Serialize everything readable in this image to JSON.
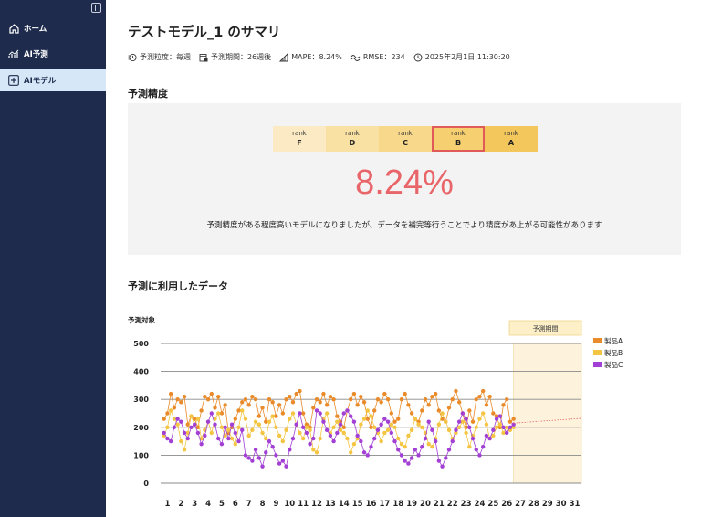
{
  "sidebar": {
    "items": [
      {
        "label": "ホーム",
        "icon": "home-icon"
      },
      {
        "label": "AI予測",
        "icon": "chart-line-icon"
      },
      {
        "label": "AIモデル",
        "icon": "ai-model-icon",
        "active": true
      }
    ]
  },
  "page": {
    "title": "テストモデル_1 のサマリ"
  },
  "meta": {
    "granularity": "予測粒度：毎週",
    "period": "予測期間：26週後",
    "mape": "MAPE：8.24%",
    "rmse": "RMSE：234",
    "timestamp": "2025年2月1日 11:30:20"
  },
  "accuracy": {
    "section_title": "予測精度",
    "ranks": [
      {
        "caption": "rank",
        "value": "F",
        "color": "#fbeac3"
      },
      {
        "caption": "rank",
        "value": "D",
        "color": "#f9e0a3"
      },
      {
        "caption": "rank",
        "value": "C",
        "color": "#f8d88b"
      },
      {
        "caption": "rank",
        "value": "B",
        "color": "#f6cf70",
        "selected": true
      },
      {
        "caption": "rank",
        "value": "A",
        "color": "#f4c75c"
      }
    ],
    "score": "8.24%",
    "comment": "予測精度がある程度高いモデルになりましたが、データを補完等行うことでより精度があ上がる可能性があります"
  },
  "data_section": {
    "title": "予測に利用したデータ"
  },
  "colors": {
    "sidebar_bg": "#1f2b4d",
    "accent_red": "#e8666a",
    "productA": "#e98b2a",
    "productB": "#f4c542",
    "productC": "#a23fd4",
    "forecast_band": "#fdf3dc"
  },
  "chart_data": {
    "type": "line",
    "ylabel": "予測対象",
    "forecast_label": "予測期間",
    "ylim": [
      0,
      500
    ],
    "yticks": [
      0,
      100,
      200,
      300,
      400,
      500
    ],
    "xticks": [
      1,
      2,
      3,
      4,
      5,
      6,
      7,
      8,
      9,
      10,
      11,
      12,
      13,
      14,
      15,
      16,
      17,
      18,
      19,
      20,
      21,
      22,
      23,
      24,
      25,
      26,
      27,
      28,
      29,
      30,
      31
    ],
    "x_range": [
      0,
      31
    ],
    "forecast_start": 26,
    "x": [
      0.25,
      0.5,
      0.75,
      1,
      1.25,
      1.5,
      1.75,
      2,
      2.25,
      2.5,
      2.75,
      3,
      3.25,
      3.5,
      3.75,
      4,
      4.25,
      4.5,
      4.75,
      5,
      5.25,
      5.5,
      5.75,
      6,
      6.25,
      6.5,
      6.75,
      7,
      7.25,
      7.5,
      7.75,
      8,
      8.25,
      8.5,
      8.75,
      9,
      9.25,
      9.5,
      9.75,
      10,
      10.25,
      10.5,
      10.75,
      11,
      11.25,
      11.5,
      11.75,
      12,
      12.25,
      12.5,
      12.75,
      13,
      13.25,
      13.5,
      13.75,
      14,
      14.25,
      14.5,
      14.75,
      15,
      15.25,
      15.5,
      15.75,
      16,
      16.25,
      16.5,
      16.75,
      17,
      17.25,
      17.5,
      17.75,
      18,
      18.25,
      18.5,
      18.75,
      19,
      19.25,
      19.5,
      19.75,
      20,
      20.25,
      20.5,
      20.75,
      21,
      21.25,
      21.5,
      21.75,
      22,
      22.25,
      22.5,
      22.75,
      23,
      23.25,
      23.5,
      23.75,
      24,
      24.25,
      24.5,
      24.75,
      25,
      25.25,
      25.5,
      25.75,
      26
    ],
    "series": [
      {
        "name": "製品A",
        "values": [
          230,
          250,
          320,
          270,
          300,
          290,
          310,
          210,
          240,
          230,
          200,
          260,
          310,
          300,
          320,
          270,
          310,
          250,
          280,
          180,
          200,
          230,
          260,
          290,
          300,
          280,
          310,
          300,
          240,
          270,
          220,
          300,
          290,
          240,
          280,
          250,
          300,
          310,
          290,
          320,
          330,
          250,
          210,
          200,
          270,
          300,
          290,
          320,
          280,
          310,
          300,
          240,
          220,
          200,
          260,
          300,
          320,
          280,
          310,
          290,
          230,
          200,
          260,
          300,
          290,
          320,
          300,
          250,
          220,
          230,
          300,
          320,
          280,
          250,
          230,
          220,
          260,
          300,
          280,
          310,
          320,
          260,
          230,
          220,
          270,
          300,
          330,
          290,
          250,
          200,
          260,
          220,
          300,
          310,
          330,
          280,
          310,
          250,
          240,
          200,
          280,
          300,
          220,
          230
        ]
      },
      {
        "name": "製品B",
        "values": [
          170,
          200,
          260,
          230,
          210,
          150,
          120,
          180,
          240,
          210,
          230,
          160,
          190,
          220,
          180,
          230,
          250,
          200,
          170,
          190,
          160,
          140,
          200,
          260,
          230,
          170,
          190,
          220,
          210,
          180,
          160,
          220,
          240,
          200,
          170,
          150,
          190,
          230,
          250,
          210,
          180,
          160,
          200,
          190,
          120,
          110,
          160,
          230,
          250,
          180,
          200,
          220,
          190,
          180,
          160,
          110,
          140,
          160,
          210,
          230,
          260,
          240,
          200,
          180,
          150,
          180,
          190,
          210,
          200,
          160,
          140,
          130,
          170,
          190,
          230,
          210,
          200,
          180,
          140,
          130,
          160,
          210,
          250,
          220,
          190,
          160,
          180,
          200,
          220,
          180,
          130,
          170,
          200,
          230,
          250,
          210,
          160,
          170,
          200,
          210,
          180,
          200,
          190,
          200
        ]
      },
      {
        "name": "製品C",
        "values": [
          180,
          160,
          150,
          200,
          230,
          220,
          180,
          160,
          200,
          210,
          180,
          140,
          170,
          220,
          250,
          210,
          160,
          140,
          200,
          160,
          210,
          180,
          150,
          190,
          100,
          90,
          80,
          120,
          90,
          60,
          110,
          150,
          130,
          100,
          70,
          80,
          60,
          120,
          160,
          210,
          250,
          200,
          180,
          140,
          160,
          260,
          250,
          220,
          190,
          170,
          150,
          180,
          210,
          250,
          260,
          240,
          220,
          170,
          150,
          110,
          100,
          130,
          160,
          190,
          210,
          230,
          220,
          180,
          150,
          120,
          100,
          80,
          70,
          90,
          120,
          100,
          130,
          160,
          220,
          190,
          150,
          80,
          60,
          90,
          120,
          150,
          190,
          220,
          250,
          230,
          200,
          160,
          120,
          100,
          130,
          170,
          160,
          190,
          230,
          240,
          200,
          180,
          200,
          210
        ]
      }
    ],
    "forecast_series": {
      "name": "製品A",
      "x": [
        26,
        31
      ],
      "values": [
        215,
        232
      ],
      "style": "dotted",
      "color": "#e8666a"
    },
    "grid": true,
    "legend": "right"
  }
}
